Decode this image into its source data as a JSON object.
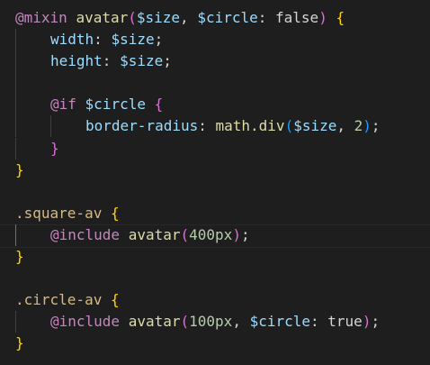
{
  "editor": {
    "lines": [
      [
        {
          "t": "@mixin",
          "c": "kw-at"
        },
        {
          "t": " "
        },
        {
          "t": "avatar",
          "c": "fn"
        },
        {
          "t": "(",
          "c": "b2"
        },
        {
          "t": "$size",
          "c": "var"
        },
        {
          "t": ", ",
          "c": "punc"
        },
        {
          "t": "$circle",
          "c": "var"
        },
        {
          "t": ": ",
          "c": "punc"
        },
        {
          "t": "false",
          "c": "plain"
        },
        {
          "t": ")",
          "c": "b2"
        },
        {
          "t": " "
        },
        {
          "t": "{",
          "c": "b1"
        }
      ],
      [
        {
          "t": "width",
          "c": "prop"
        },
        {
          "t": ": ",
          "c": "punc"
        },
        {
          "t": "$size",
          "c": "var"
        },
        {
          "t": ";",
          "c": "punc"
        }
      ],
      [
        {
          "t": "height",
          "c": "prop"
        },
        {
          "t": ": ",
          "c": "punc"
        },
        {
          "t": "$size",
          "c": "var"
        },
        {
          "t": ";",
          "c": "punc"
        }
      ],
      [],
      [
        {
          "t": "@if",
          "c": "kw"
        },
        {
          "t": " "
        },
        {
          "t": "$circle",
          "c": "var"
        },
        {
          "t": " "
        },
        {
          "t": "{",
          "c": "b2"
        }
      ],
      [
        {
          "t": "border-radius",
          "c": "prop"
        },
        {
          "t": ": ",
          "c": "punc"
        },
        {
          "t": "math.div",
          "c": "fn"
        },
        {
          "t": "(",
          "c": "b3"
        },
        {
          "t": "$size",
          "c": "var"
        },
        {
          "t": ", ",
          "c": "punc"
        },
        {
          "t": "2",
          "c": "num"
        },
        {
          "t": ")",
          "c": "b3"
        },
        {
          "t": ";",
          "c": "punc"
        }
      ],
      [
        {
          "t": "}",
          "c": "b2"
        }
      ],
      [
        {
          "t": "}",
          "c": "b1"
        }
      ],
      [],
      [
        {
          "t": ".square-av",
          "c": "sel"
        },
        {
          "t": " "
        },
        {
          "t": "{",
          "c": "b1"
        }
      ],
      [
        {
          "t": "@include",
          "c": "kw"
        },
        {
          "t": " "
        },
        {
          "t": "avatar",
          "c": "fn"
        },
        {
          "t": "(",
          "c": "b2"
        },
        {
          "t": "400px",
          "c": "num"
        },
        {
          "t": ")",
          "c": "b2"
        },
        {
          "t": ";",
          "c": "punc"
        }
      ],
      [
        {
          "t": "}",
          "c": "b1"
        }
      ],
      [],
      [
        {
          "t": ".circle-av",
          "c": "sel"
        },
        {
          "t": " "
        },
        {
          "t": "{",
          "c": "b1"
        }
      ],
      [
        {
          "t": "@include",
          "c": "kw"
        },
        {
          "t": " "
        },
        {
          "t": "avatar",
          "c": "fn"
        },
        {
          "t": "(",
          "c": "b2"
        },
        {
          "t": "100px",
          "c": "num"
        },
        {
          "t": ", ",
          "c": "punc"
        },
        {
          "t": "$circle",
          "c": "var"
        },
        {
          "t": ": ",
          "c": "punc"
        },
        {
          "t": "true",
          "c": "plain"
        },
        {
          "t": ")",
          "c": "b2"
        },
        {
          "t": ";",
          "c": "punc"
        }
      ],
      [
        {
          "t": "}",
          "c": "b1"
        }
      ]
    ],
    "indent_levels": [
      0,
      1,
      1,
      0,
      1,
      2,
      1,
      0,
      0,
      0,
      1,
      0,
      0,
      0,
      1,
      0
    ]
  }
}
